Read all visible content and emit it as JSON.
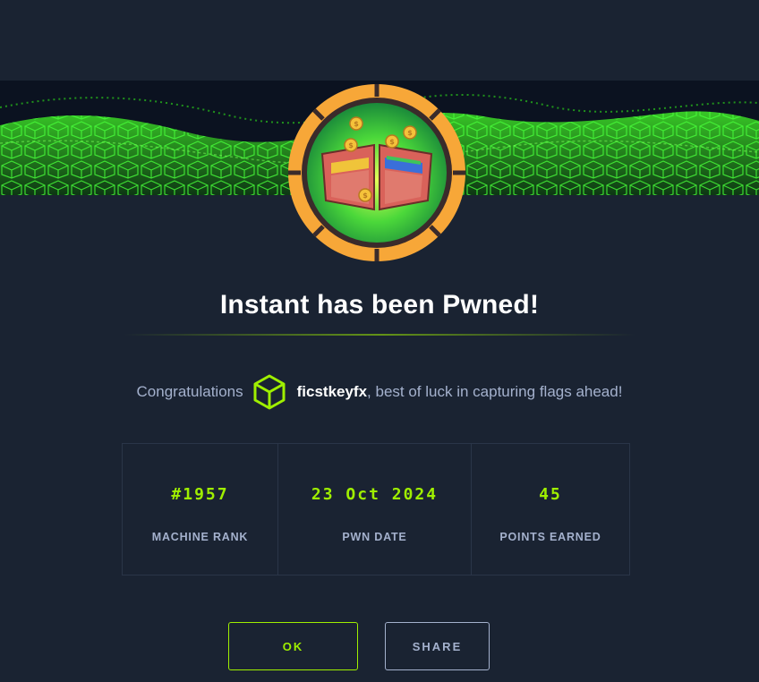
{
  "dialog": {
    "title": "Instant has been Pwned!",
    "congrats_prefix": "Congratulations",
    "username": "ficstkeyfx",
    "congrats_suffix": ", best of luck in capturing flags ahead!"
  },
  "stats": [
    {
      "value": "#1957",
      "label": "MACHINE RANK"
    },
    {
      "value": "23 Oct 2024",
      "label": "PWN DATE"
    },
    {
      "value": "45",
      "label": "POINTS EARNED"
    }
  ],
  "buttons": {
    "ok": "OK",
    "share": "SHARE"
  },
  "icons": {
    "badge": "wallet-coins-badge-icon",
    "user": "hexagon-cube-icon"
  },
  "colors": {
    "background": "#1a2332",
    "accent": "#9fef00",
    "muted": "#a4b1cd",
    "badge_ring": "#f7a738"
  }
}
